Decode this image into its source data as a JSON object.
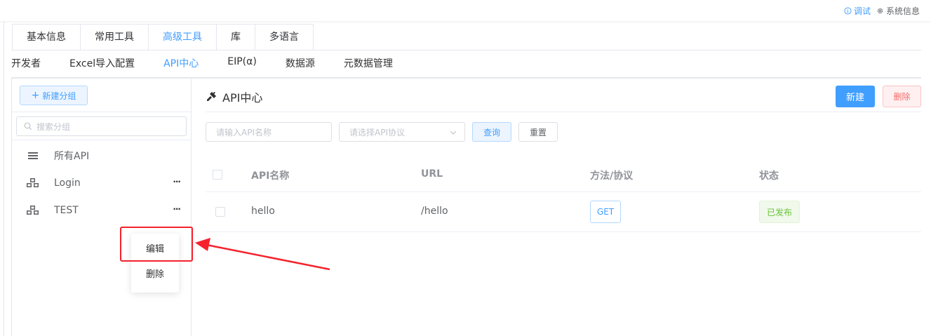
{
  "topbar": {
    "debug_label": "调试",
    "system_label": "系统信息"
  },
  "tabs_primary": [
    {
      "label": "基本信息"
    },
    {
      "label": "常用工具"
    },
    {
      "label": "高级工具"
    },
    {
      "label": "库"
    },
    {
      "label": "多语言"
    }
  ],
  "tabs_primary_active": "高级工具",
  "tabs_secondary": [
    {
      "label": "开发者"
    },
    {
      "label": "Excel导入配置"
    },
    {
      "label": "API中心"
    },
    {
      "label": "EIP(α)"
    },
    {
      "label": "数据源"
    },
    {
      "label": "元数据管理"
    }
  ],
  "tabs_secondary_active": "API中心",
  "sidebar": {
    "new_group_label": "新建分组",
    "search_placeholder": "搜索分组",
    "groups": [
      {
        "label": "所有API",
        "icon": "list-icon",
        "has_more": false
      },
      {
        "label": "Login",
        "icon": "cubes-icon",
        "has_more": true
      },
      {
        "label": "TEST",
        "icon": "cubes-icon",
        "has_more": true
      }
    ],
    "more_label": "···"
  },
  "context_menu": {
    "edit_label": "编辑",
    "delete_label": "删除"
  },
  "main": {
    "title": "API中心",
    "new_button": "新建",
    "delete_button": "删除",
    "filter": {
      "name_placeholder": "请输入API名称",
      "protocol_placeholder": "请选择API协议",
      "query_button": "查询",
      "reset_button": "重置"
    },
    "table": {
      "columns": [
        "API名称",
        "URL",
        "方法/协议",
        "状态"
      ],
      "rows": [
        {
          "name": "hello",
          "url": "/hello",
          "method": "GET",
          "status": "已发布"
        }
      ]
    }
  },
  "colors": {
    "accent": "#409eff",
    "danger": "#f56c6c",
    "success": "#67c23a",
    "highlight": "#f5222d"
  }
}
